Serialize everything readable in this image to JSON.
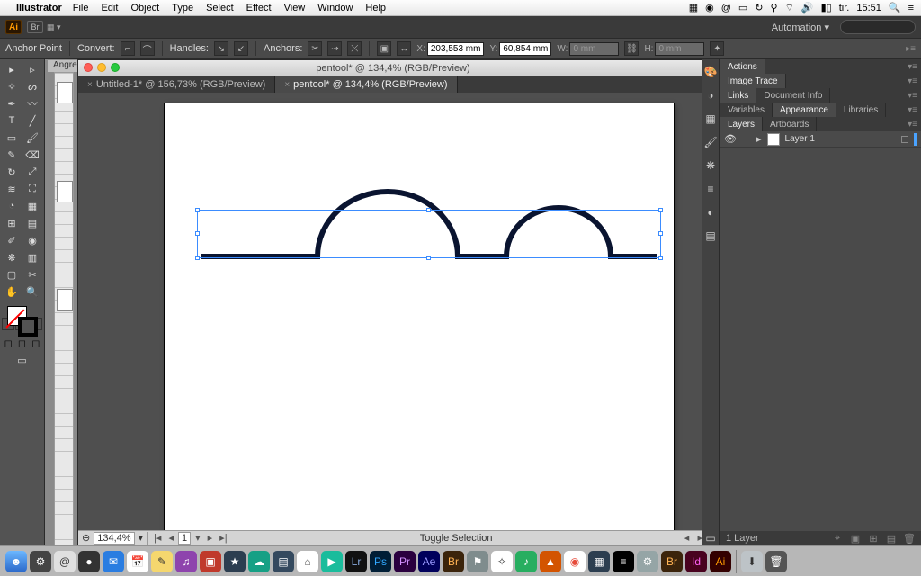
{
  "menubar": {
    "app": "Illustrator",
    "items": [
      "File",
      "Edit",
      "Object",
      "Type",
      "Select",
      "Effect",
      "View",
      "Window",
      "Help"
    ],
    "clock_day": "tir.",
    "clock_time": "15:51"
  },
  "appbar": {
    "ai": "Ai",
    "br": "Br",
    "workspace": "Automation"
  },
  "controlbar": {
    "anchor_label": "Anchor Point",
    "convert_label": "Convert:",
    "handles_label": "Handles:",
    "anchors_label": "Anchors:",
    "x_label": "X:",
    "x_value": "203,553 mm",
    "y_label": "Y:",
    "y_value": "60,854 mm",
    "w_label": "W:",
    "w_value": "0 mm",
    "h_label": "H:",
    "h_value": "0 mm"
  },
  "behind_tab": "Angre  L",
  "docwin": {
    "title": "pentool* @ 134,4% (RGB/Preview)",
    "tabs": [
      {
        "label": "Untitled-1* @ 156,73% (RGB/Preview)",
        "active": false
      },
      {
        "label": "pentool* @ 134,4% (RGB/Preview)",
        "active": true
      }
    ],
    "status": {
      "zoom": "134,4%",
      "artboard_num": "1",
      "center": "Toggle Selection"
    }
  },
  "panels": {
    "row1": [
      "Actions"
    ],
    "row2": [
      "Image Trace"
    ],
    "row3": [
      "Links",
      "Document Info"
    ],
    "row4": [
      "Variables",
      "Appearance",
      "Libraries"
    ],
    "row5": [
      "Layers",
      "Artboards"
    ],
    "layer_name": "Layer 1",
    "footer": "1 Layer"
  },
  "chart_data": {
    "type": "path",
    "note": "Vector path drawn on artboard: baseline with two upward semicircular arches.",
    "stroke": "#0a1430",
    "stroke_width_px": 6,
    "baseline_y_mm": 60.854,
    "selected_anchor_x_mm": 203.553,
    "arches": [
      {
        "approx_center_x_ratio": 0.43,
        "approx_radius_ratio": 0.16
      },
      {
        "approx_center_x_ratio": 0.74,
        "approx_radius_ratio": 0.11
      }
    ]
  }
}
